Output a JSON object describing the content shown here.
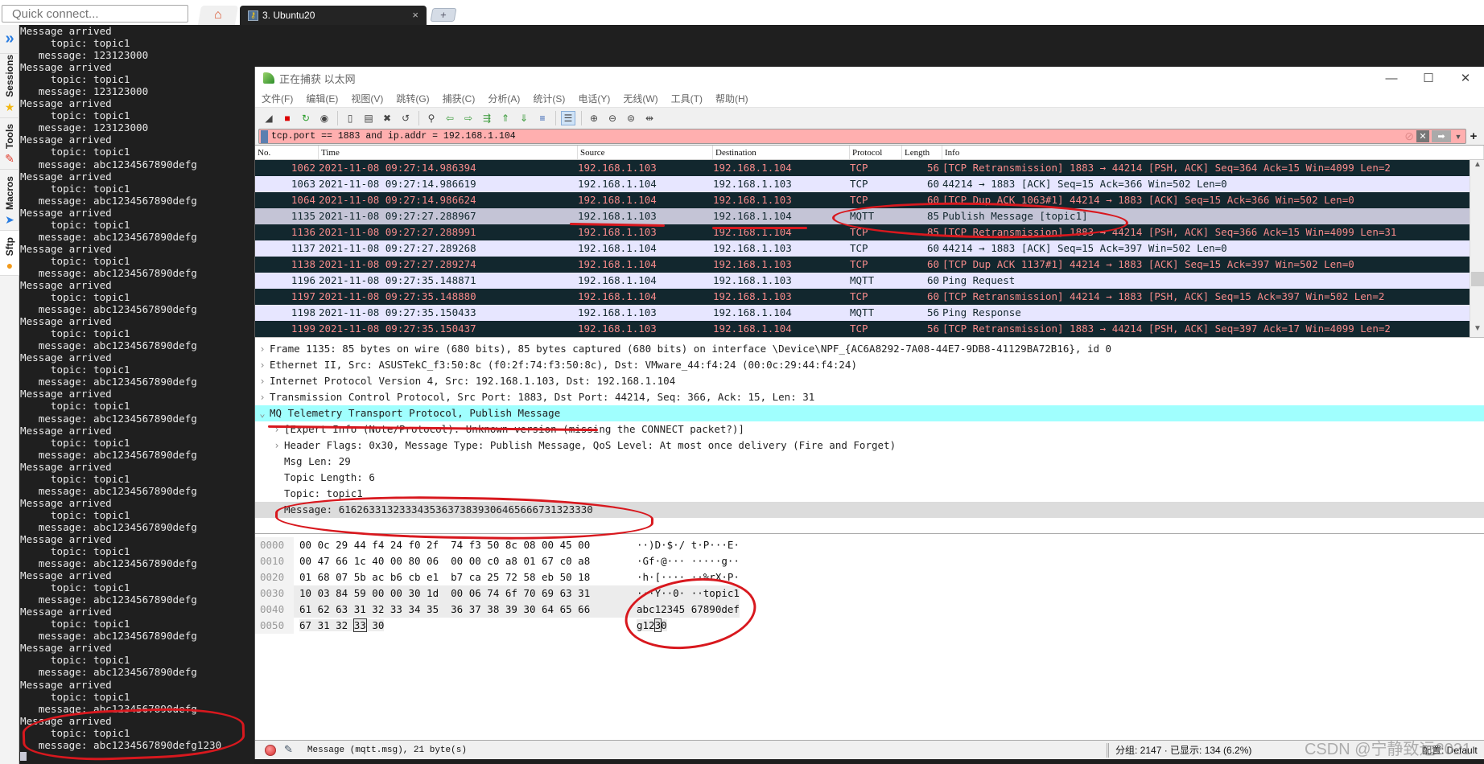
{
  "topbar": {
    "quick_connect_placeholder": "Quick connect...",
    "home_icon": "home-icon",
    "session_tab_label": "3. Ubuntu20",
    "session_tab_close": "×",
    "new_tab": "+"
  },
  "sidetabs": [
    {
      "label": "Sessions",
      "icon": "★"
    },
    {
      "label": "Tools",
      "icon": "✎"
    },
    {
      "label": "Macros",
      "icon": "➤"
    },
    {
      "label": "Sftp",
      "icon": "●"
    }
  ],
  "sidebar_toggle": "»",
  "terminal": {
    "lines": [
      "Message arrived",
      "     topic: topic1",
      "   message: 123123000",
      "Message arrived",
      "     topic: topic1",
      "   message: 123123000",
      "Message arrived",
      "     topic: topic1",
      "   message: 123123000",
      "Message arrived",
      "     topic: topic1",
      "   message: abc1234567890defg",
      "Message arrived",
      "     topic: topic1",
      "   message: abc1234567890defg",
      "Message arrived",
      "     topic: topic1",
      "   message: abc1234567890defg",
      "Message arrived",
      "     topic: topic1",
      "   message: abc1234567890defg",
      "Message arrived",
      "     topic: topic1",
      "   message: abc1234567890defg",
      "Message arrived",
      "     topic: topic1",
      "   message: abc1234567890defg",
      "Message arrived",
      "     topic: topic1",
      "   message: abc1234567890defg",
      "Message arrived",
      "     topic: topic1",
      "   message: abc1234567890defg",
      "Message arrived",
      "     topic: topic1",
      "   message: abc1234567890defg",
      "Message arrived",
      "     topic: topic1",
      "   message: abc1234567890defg",
      "Message arrived",
      "     topic: topic1",
      "   message: abc1234567890defg",
      "Message arrived",
      "     topic: topic1",
      "   message: abc1234567890defg",
      "Message arrived",
      "     topic: topic1",
      "   message: abc1234567890defg",
      "Message arrived",
      "     topic: topic1",
      "   message: abc1234567890defg",
      "Message arrived",
      "     topic: topic1",
      "   message: abc1234567890defg",
      "Message arrived",
      "     topic: topic1",
      "   message: abc1234567890defg",
      "Message arrived",
      "     topic: topic1",
      "   message: abc1234567890defg1230"
    ]
  },
  "wireshark": {
    "title": "正在捕获 以太网",
    "window_controls": [
      "—",
      "☐",
      "✕"
    ],
    "menu": [
      "文件(F)",
      "编辑(E)",
      "视图(V)",
      "跳转(G)",
      "捕获(C)",
      "分析(A)",
      "统计(S)",
      "电话(Y)",
      "无线(W)",
      "工具(T)",
      "帮助(H)"
    ],
    "toolbar_icons": [
      "shark-fin-start-icon",
      "stop-capture-icon",
      "restart-capture-icon",
      "capture-options-icon",
      "open-file-icon",
      "save-file-icon",
      "close-file-icon",
      "reload-file-icon",
      "find-packet-icon",
      "go-back-icon",
      "go-forward-icon",
      "go-to-packet-icon",
      "go-first-icon",
      "go-last-icon",
      "auto-scroll-icon",
      "colorize-icon",
      "zoom-in-icon",
      "zoom-out-icon",
      "normal-size-icon",
      "resize-columns-icon"
    ],
    "filter": {
      "value": "tcp.port == 1883 and ip.addr = 192.168.1.104",
      "plus": "+"
    },
    "columns": [
      "No.",
      "Time",
      "Source",
      "Destination",
      "Protocol",
      "Length",
      "Info"
    ],
    "packets": [
      {
        "no": "1062",
        "time": "2021-11-08 09:27:14.986394",
        "src": "192.168.1.103",
        "dst": "192.168.1.104",
        "proto": "TCP",
        "len": "56",
        "info": "[TCP Retransmission] 1883 → 44214 [PSH, ACK] Seq=364 Ack=15 Win=4099 Len=2",
        "style": "dark"
      },
      {
        "no": "1063",
        "time": "2021-11-08 09:27:14.986619",
        "src": "192.168.1.104",
        "dst": "192.168.1.103",
        "proto": "TCP",
        "len": "60",
        "info": "44214 → 1883 [ACK] Seq=15 Ack=366 Win=502 Len=0",
        "style": "light"
      },
      {
        "no": "1064",
        "time": "2021-11-08 09:27:14.986624",
        "src": "192.168.1.104",
        "dst": "192.168.1.103",
        "proto": "TCP",
        "len": "60",
        "info": "[TCP Dup ACK 1063#1] 44214 → 1883 [ACK] Seq=15 Ack=366 Win=502 Len=0",
        "style": "dark"
      },
      {
        "no": "1135",
        "time": "2021-11-08 09:27:27.288967",
        "src": "192.168.1.103",
        "dst": "192.168.1.104",
        "proto": "MQTT",
        "len": "85",
        "info": "Publish Message [topic1]",
        "style": "sel"
      },
      {
        "no": "1136",
        "time": "2021-11-08 09:27:27.288991",
        "src": "192.168.1.103",
        "dst": "192.168.1.104",
        "proto": "TCP",
        "len": "85",
        "info": "[TCP Retransmission] 1883 → 44214 [PSH, ACK] Seq=366 Ack=15 Win=4099 Len=31",
        "style": "dark"
      },
      {
        "no": "1137",
        "time": "2021-11-08 09:27:27.289268",
        "src": "192.168.1.104",
        "dst": "192.168.1.103",
        "proto": "TCP",
        "len": "60",
        "info": "44214 → 1883 [ACK] Seq=15 Ack=397 Win=502 Len=0",
        "style": "light"
      },
      {
        "no": "1138",
        "time": "2021-11-08 09:27:27.289274",
        "src": "192.168.1.104",
        "dst": "192.168.1.103",
        "proto": "TCP",
        "len": "60",
        "info": "[TCP Dup ACK 1137#1] 44214 → 1883 [ACK] Seq=15 Ack=397 Win=502 Len=0",
        "style": "dark"
      },
      {
        "no": "1196",
        "time": "2021-11-08 09:27:35.148871",
        "src": "192.168.1.104",
        "dst": "192.168.1.103",
        "proto": "MQTT",
        "len": "60",
        "info": "Ping Request",
        "style": "light"
      },
      {
        "no": "1197",
        "time": "2021-11-08 09:27:35.148880",
        "src": "192.168.1.104",
        "dst": "192.168.1.103",
        "proto": "TCP",
        "len": "60",
        "info": "[TCP Retransmission] 44214 → 1883 [PSH, ACK] Seq=15 Ack=397 Win=502 Len=2",
        "style": "dark"
      },
      {
        "no": "1198",
        "time": "2021-11-08 09:27:35.150433",
        "src": "192.168.1.103",
        "dst": "192.168.1.104",
        "proto": "MQTT",
        "len": "56",
        "info": "Ping Response",
        "style": "light"
      },
      {
        "no": "1199",
        "time": "2021-11-08 09:27:35.150437",
        "src": "192.168.1.103",
        "dst": "192.168.1.104",
        "proto": "TCP",
        "len": "56",
        "info": "[TCP Retransmission] 1883 → 44214 [PSH, ACK] Seq=397 Ack=17 Win=4099 Len=2",
        "style": "dark"
      }
    ],
    "details": [
      {
        "text": "Frame 1135: 85 bytes on wire (680 bits), 85 bytes captured (680 bits) on interface \\Device\\NPF_{AC6A8292-7A08-44E7-9DB8-41129BA72B16}, id 0",
        "arrow": "›",
        "level": 0,
        "style": ""
      },
      {
        "text": "Ethernet II, Src: ASUSTekC_f3:50:8c (f0:2f:74:f3:50:8c), Dst: VMware_44:f4:24 (00:0c:29:44:f4:24)",
        "arrow": "›",
        "level": 0,
        "style": ""
      },
      {
        "text": "Internet Protocol Version 4, Src: 192.168.1.103, Dst: 192.168.1.104",
        "arrow": "›",
        "level": 0,
        "style": ""
      },
      {
        "text": "Transmission Control Protocol, Src Port: 1883, Dst Port: 44214, Seq: 366, Ack: 15, Len: 31",
        "arrow": "›",
        "level": 0,
        "style": ""
      },
      {
        "text": "MQ Telemetry Transport Protocol, Publish Message",
        "arrow": "⌄",
        "level": 0,
        "style": "hl"
      },
      {
        "text": "[Expert Info (Note/Protocol): Unknown version (missing the CONNECT packet?)]",
        "arrow": "›",
        "level": 1,
        "style": ""
      },
      {
        "text": "Header Flags: 0x30, Message Type: Publish Message, QoS Level: At most once delivery (Fire and Forget)",
        "arrow": "›",
        "level": 1,
        "style": ""
      },
      {
        "text": "Msg Len: 29",
        "arrow": "",
        "level": 1,
        "style": ""
      },
      {
        "text": "Topic Length: 6",
        "arrow": "",
        "level": 1,
        "style": ""
      },
      {
        "text": "Topic: topic1",
        "arrow": "",
        "level": 1,
        "style": ""
      },
      {
        "text": "Message: 616263313233343536373839306465666731323330",
        "arrow": "",
        "level": 1,
        "style": "gray"
      }
    ],
    "bytes": [
      {
        "off": "0000",
        "hex": "00 0c 29 44 f4 24 f0 2f  74 f3 50 8c 08 00 45 00",
        "asc": "··)D·$·/ t·P···E·",
        "sh": false
      },
      {
        "off": "0010",
        "hex": "00 47 66 1c 40 00 80 06  00 00 c0 a8 01 67 c0 a8",
        "asc": "·Gf·@··· ·····g··",
        "sh": false
      },
      {
        "off": "0020",
        "hex": "01 68 07 5b ac b6 cb e1  b7 ca 25 72 58 eb 50 18",
        "asc": "·h·[···· ··%rX·P·",
        "sh": false
      },
      {
        "off": "0030",
        "hex": "10 03 84 59 00 00 30 1d  00 06 74 6f 70 69 63 31",
        "asc": "···Y··0· ··topic1",
        "sh": true
      },
      {
        "off": "0040",
        "hex": "61 62 63 31 32 33 34 35  36 37 38 39 30 64 65 66",
        "asc": "abc12345 67890def",
        "sh": true
      },
      {
        "off": "0050",
        "hex_pre": "67 31 32 ",
        "hex_box": "33",
        "hex_post": " 30",
        "asc_pre": "g12",
        "asc_box": "3",
        "asc_post": "0",
        "sh": true
      }
    ],
    "status": {
      "message": "Message (mqtt.msg), 21 byte(s)",
      "packets": "分组: 2147 · 已显示: 134 (6.2%)",
      "profile": "配置: Default"
    }
  },
  "watermark": "CSDN @宁静致远2021"
}
